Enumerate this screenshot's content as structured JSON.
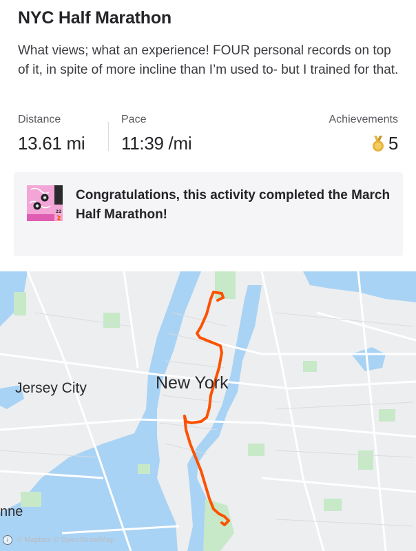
{
  "activity": {
    "title": "NYC Half Marathon",
    "description": "What views; what an experience! FOUR personal records on top of it, in spite of more incline than I’m used to- but I trained for that."
  },
  "stats": {
    "distance": {
      "label": "Distance",
      "value": "13.61 mi"
    },
    "pace": {
      "label": "Pace",
      "value": "11:39 /mi"
    },
    "achievements": {
      "label": "Achievements",
      "value": "5",
      "icon": "gold-medal-icon"
    }
  },
  "challenge": {
    "text": "Congratulations, this activity completed the March Half Marathon!",
    "badge_text": "21.1 KM"
  },
  "map": {
    "labels": {
      "jersey_city": "Jersey City",
      "new_york": "New York",
      "partial": "nne"
    },
    "attribution": "© Mapbox © OpenStreetMap",
    "route_color": "#fc5200",
    "water_color": "#a9d3f5",
    "park_color": "#c7e9c8"
  }
}
